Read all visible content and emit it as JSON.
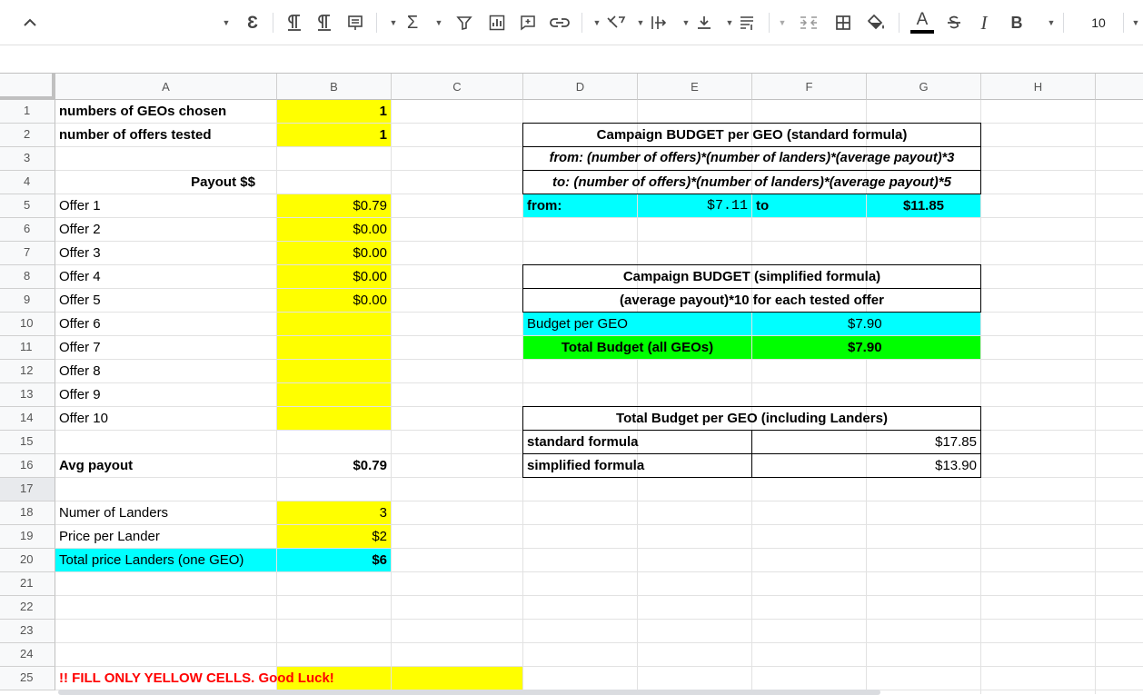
{
  "toolbar": {
    "font_size": "10",
    "icons": [
      "chevron-up-icon",
      "special-char-icon",
      "ltr-icon",
      "rtl-icon",
      "insert-note-icon",
      "function-icon",
      "filter-icon",
      "chart-icon",
      "comment-icon",
      "link-icon",
      "text-rotation-icon",
      "horizontal-align-icon",
      "vertical-align-icon",
      "wrap-icon",
      "merge-icon",
      "borders-icon",
      "fill-color-icon",
      "text-color-icon",
      "strikethrough-icon",
      "italic-icon",
      "bold-icon"
    ],
    "labels": {
      "function": "Σ",
      "special": "Ɛ",
      "italic": "I",
      "bold": "B",
      "text_color": "A"
    }
  },
  "columns": [
    "A",
    "B",
    "C",
    "D",
    "E",
    "F",
    "G",
    "H"
  ],
  "rows": [
    "1",
    "2",
    "3",
    "4",
    "5",
    "6",
    "7",
    "8",
    "9",
    "10",
    "11",
    "12",
    "13",
    "14",
    "15",
    "16",
    "17",
    "18",
    "19",
    "20",
    "21",
    "22",
    "23",
    "24",
    "25"
  ],
  "cells": {
    "A1": "numbers of GEOs chosen",
    "B1": "1",
    "A2": "number of offers tested",
    "B2": "1",
    "A4": "Payout $$",
    "A5": "Offer 1",
    "B5": "$0.79",
    "A6": "Offer 2",
    "B6": "$0.00",
    "A7": "Offer 3",
    "B7": "$0.00",
    "A8": "Offer 4",
    "B8": "$0.00",
    "A9": "Offer 5",
    "B9": "$0.00",
    "A10": "Offer 6",
    "A11": "Offer 7",
    "A12": "Offer 8",
    "A13": "Offer 9",
    "A14": "Offer 10",
    "A16": "Avg payout",
    "B16": "$0.79",
    "A18": "Numer of Landers",
    "B18": "3",
    "A19": "Price per Lander",
    "B19": "$2",
    "A20": "Total price Landers (one GEO)",
    "B20": "$6",
    "A25": "!! FILL ONLY YELLOW CELLS. Good Luck!",
    "D2": "Campaign BUDGET per GEO (standard formula)",
    "D3": "from: (number of offers)*(number of landers)*(average payout)*3",
    "D4": "to: (number of offers)*(number of landers)*(average payout)*5",
    "D5": "from:",
    "E5": "$7.11",
    "E5b": "to",
    "G5": "$11.85",
    "D8": "Campaign BUDGET (simplified formula)",
    "D9": "(average payout)*10 for each tested offer",
    "D10": "Budget per GEO",
    "F10": "$7.90",
    "D11": "Total Budget (all GEOs)",
    "F11": "$7.90",
    "D14": "Total Budget per GEO (including Landers)",
    "D15": "standard formula",
    "G15": "$17.85",
    "D16": "simplified formula",
    "G16": "$13.90"
  },
  "colors": {
    "yellow": "#ffff00",
    "cyan": "#00ffff",
    "green": "#00ff00",
    "warning_red": "#ff0000"
  }
}
